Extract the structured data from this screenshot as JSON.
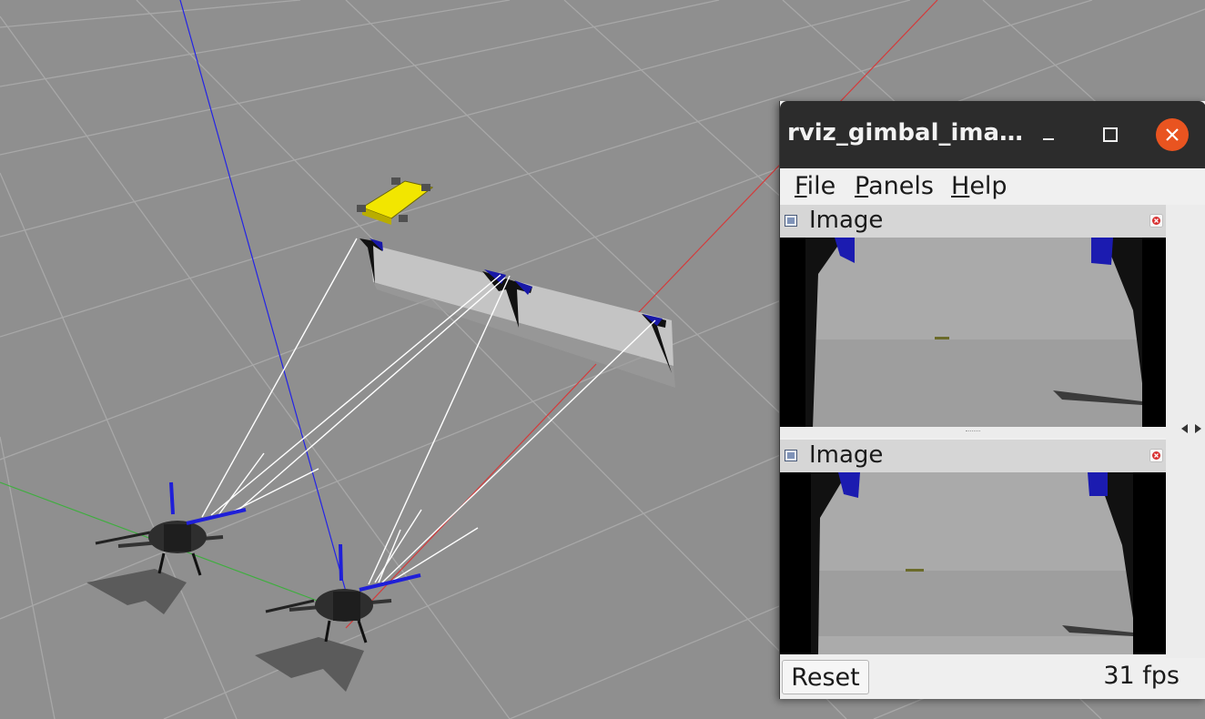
{
  "scene": {
    "description_free": true,
    "colors": {
      "ground": "#8f8f8f",
      "grid": "#a6a6a6",
      "wall": "#c4c4c4",
      "rover": "#f2e600",
      "axis_x": "#d93a3a",
      "axis_y": "#3ca83c",
      "axis_z": "#1f1fe0",
      "ray": "#ffffff",
      "marker": "#1a1aa0"
    },
    "objects": [
      "rover",
      "wall",
      "marker",
      "drone",
      "drone"
    ]
  },
  "window": {
    "title": "rviz_gimbal_ima…",
    "icons": [
      "minimize-icon",
      "maximize-icon",
      "close-icon"
    ],
    "close_color": "#e95420"
  },
  "menu": {
    "items": [
      {
        "label": "File"
      },
      {
        "label": "Panels"
      },
      {
        "label": "Help"
      }
    ]
  },
  "panels": [
    {
      "title": "Image",
      "icon": "image-icon",
      "close_icon": "panel-close-icon"
    },
    {
      "title": "Image",
      "icon": "image-icon",
      "close_icon": "panel-close-icon"
    }
  ],
  "footer": {
    "reset_label": "Reset",
    "fps_text": "31 fps"
  }
}
